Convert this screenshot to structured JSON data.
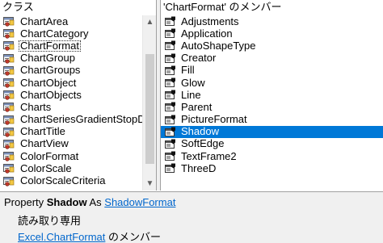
{
  "classes_pane": {
    "header": "クラス",
    "items": [
      {
        "label": "ChartArea",
        "icon": "class-icon"
      },
      {
        "label": "ChartCategory",
        "icon": "class-icon"
      },
      {
        "label": "ChartFormat",
        "icon": "class-icon",
        "focused": true
      },
      {
        "label": "ChartGroup",
        "icon": "class-icon"
      },
      {
        "label": "ChartGroups",
        "icon": "class-icon"
      },
      {
        "label": "ChartObject",
        "icon": "class-icon"
      },
      {
        "label": "ChartObjects",
        "icon": "class-icon"
      },
      {
        "label": "Charts",
        "icon": "class-icon"
      },
      {
        "label": "ChartSeriesGradientStopD",
        "icon": "class-icon"
      },
      {
        "label": "ChartTitle",
        "icon": "class-icon"
      },
      {
        "label": "ChartView",
        "icon": "class-icon"
      },
      {
        "label": "ColorFormat",
        "icon": "class-icon"
      },
      {
        "label": "ColorScale",
        "icon": "class-icon"
      },
      {
        "label": "ColorScaleCriteria",
        "icon": "class-icon"
      }
    ]
  },
  "members_pane": {
    "header": "'ChartFormat' のメンバー",
    "items": [
      {
        "label": "Adjustments",
        "icon": "property-icon"
      },
      {
        "label": "Application",
        "icon": "property-icon"
      },
      {
        "label": "AutoShapeType",
        "icon": "property-icon"
      },
      {
        "label": "Creator",
        "icon": "property-icon"
      },
      {
        "label": "Fill",
        "icon": "property-icon"
      },
      {
        "label": "Glow",
        "icon": "property-icon"
      },
      {
        "label": "Line",
        "icon": "property-icon"
      },
      {
        "label": "Parent",
        "icon": "property-icon"
      },
      {
        "label": "PictureFormat",
        "icon": "property-icon"
      },
      {
        "label": "Shadow",
        "icon": "property-icon",
        "selected": true
      },
      {
        "label": "SoftEdge",
        "icon": "property-icon"
      },
      {
        "label": "TextFrame2",
        "icon": "property-icon"
      },
      {
        "label": "ThreeD",
        "icon": "property-icon"
      }
    ]
  },
  "details": {
    "prefix": "Property ",
    "member_name": "Shadow",
    "as_text": " As ",
    "type_link": "ShadowFormat",
    "readonly": "読み取り専用",
    "library_link": "Excel",
    "dot": ".",
    "class_link": "ChartFormat",
    "member_of_suffix": " のメンバー"
  },
  "colors": {
    "selection": "#0078d7",
    "link": "#0066cc",
    "panel_bg": "#f0f0f0"
  }
}
